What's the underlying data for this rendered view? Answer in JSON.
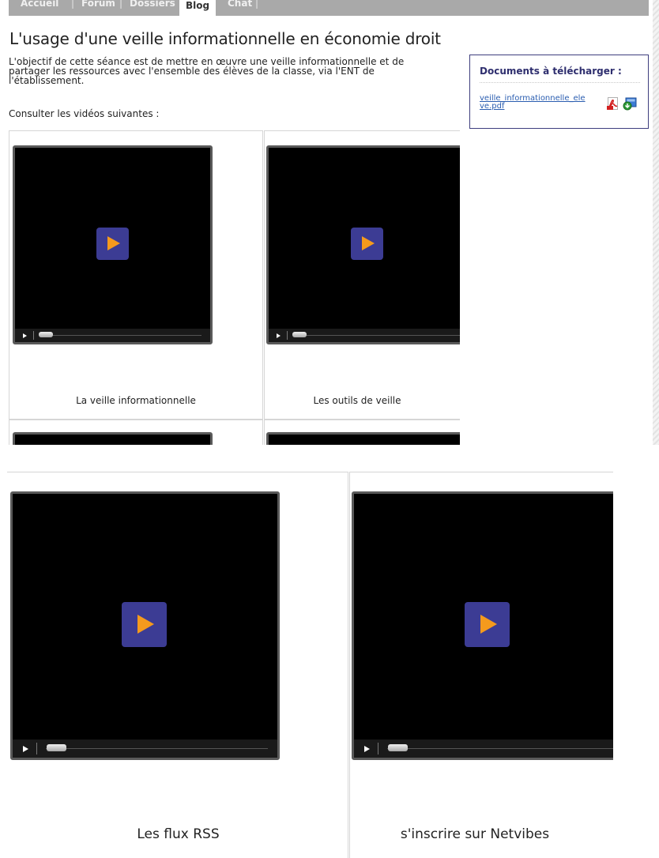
{
  "nav": {
    "items": [
      "Accueil",
      "Forum",
      "Dossiers",
      "Blog",
      "Chat"
    ],
    "active": "Blog"
  },
  "page": {
    "title": "L'usage d'une veille informationnelle en économie droit",
    "intro_lines": [
      "L'objectif de cette séance est de mettre en œuvre une veille informationnelle et de",
      "partager les ressources avec l'ensemble des élèves de la classe, via l'ENT de",
      "l'établissement."
    ],
    "consult": "Consulter les vidéos suivantes :"
  },
  "sidebox": {
    "title": "Documents à télécharger :",
    "file_line1": "veille_informationnelle_ele",
    "file_line2": "ve.pdf",
    "icons": [
      "pdf-icon",
      "download-icon"
    ]
  },
  "videos": [
    {
      "caption": "La veille informationnelle"
    },
    {
      "caption": "Les outils de veille"
    },
    {
      "caption": "Les flux RSS"
    },
    {
      "caption": "s'inscrire sur Netvibes"
    }
  ],
  "colors": {
    "play_button": "#3c3c94",
    "play_arrow": "#f59a1d",
    "nav_bar": "#a9a9a9",
    "link": "#2a5db0",
    "sidebox_border": "#3e3e7e"
  }
}
